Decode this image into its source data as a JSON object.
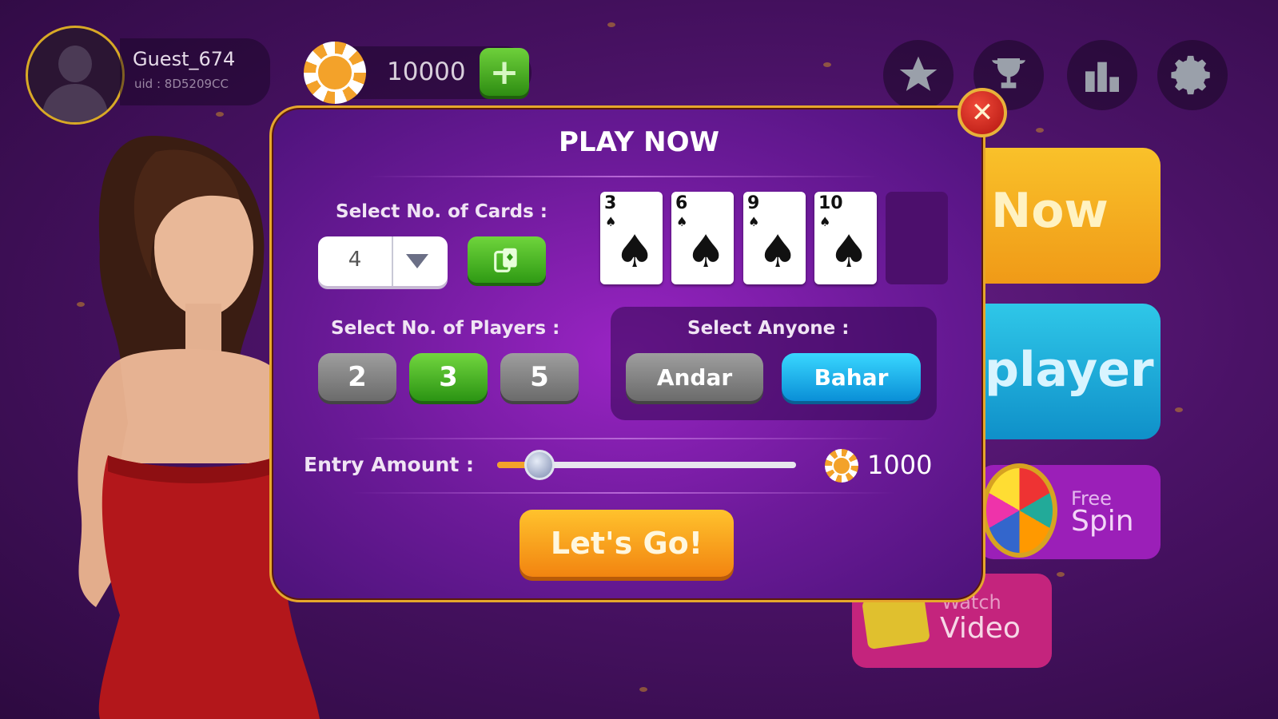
{
  "user": {
    "name": "Guest_674",
    "uid": "uid : 8D5209CC"
  },
  "wallet": {
    "balance": "10000",
    "add_label": "+"
  },
  "top_icons": [
    "star-icon",
    "trophy-icon",
    "leaderboard-icon",
    "gear-icon"
  ],
  "background_buttons": {
    "play_now": "Now",
    "multiplayer": "player",
    "free_spin": {
      "line1": "Free",
      "line2": "Spin"
    },
    "watch_video": {
      "line1": "Watch",
      "line2": "Video"
    }
  },
  "dialog": {
    "title": "PLAY NOW",
    "close_label": "✕",
    "cards_label": "Select No. of Cards :",
    "cards_selected": "4",
    "cards": [
      {
        "rank": "3",
        "suit": "♠"
      },
      {
        "rank": "6",
        "suit": "♠"
      },
      {
        "rank": "9",
        "suit": "♠"
      },
      {
        "rank": "10",
        "suit": "♠"
      }
    ],
    "players_label": "Select No. of Players :",
    "player_options": [
      "2",
      "3",
      "5"
    ],
    "player_selected": "3",
    "anyone_label": "Select Anyone :",
    "side_options": [
      "Andar",
      "Bahar"
    ],
    "side_selected": "Bahar",
    "entry_label": "Entry Amount :",
    "entry_value": "1000",
    "entry_slider_fraction": 0.1,
    "go_label": "Let's Go!"
  },
  "colors": {
    "accent_gold": "#e6a72c",
    "selected_green": "#2b9413",
    "selected_blue": "#0a8fd7",
    "dialog_purple": "#6c1a99"
  }
}
